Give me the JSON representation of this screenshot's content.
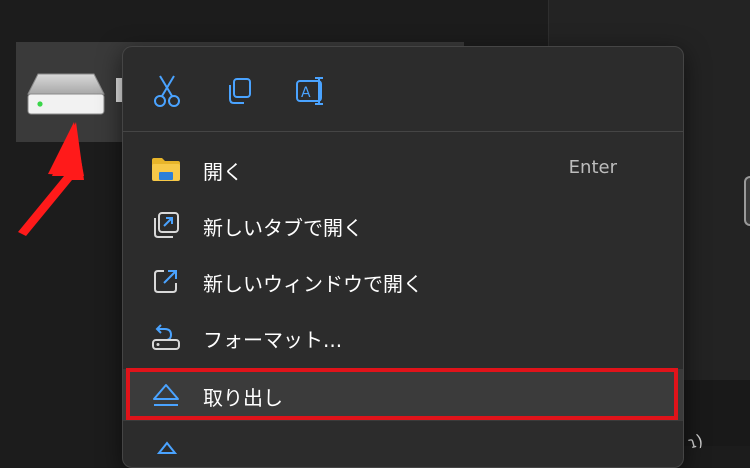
{
  "background": {
    "dark": "#1c1c1c",
    "panel": "#232323"
  },
  "drive": {
    "icon": "hard-drive-icon",
    "tile_color": "#3a3a3a",
    "status_led": "#3bd64a"
  },
  "annotation": {
    "arrow_color": "#ff1a1a",
    "highlight_color": "#e0131a"
  },
  "context_menu": {
    "toolbar": [
      {
        "icon": "cut-icon",
        "name": "cut"
      },
      {
        "icon": "copy-icon",
        "name": "copy"
      },
      {
        "icon": "rename-icon",
        "name": "rename"
      }
    ],
    "items": [
      {
        "label": "開く",
        "shortcut": "Enter",
        "icon": "folder-icon"
      },
      {
        "label": "新しいタブで開く",
        "shortcut": "",
        "icon": "open-in-new-tab-icon"
      },
      {
        "label": "新しいウィンドウで開く",
        "shortcut": "",
        "icon": "open-in-new-window-icon"
      },
      {
        "label": "フォーマット...",
        "shortcut": "",
        "icon": "format-drive-icon"
      },
      {
        "label": "取り出し",
        "shortcut": "",
        "icon": "eject-icon",
        "highlighted": true
      }
    ],
    "accent": "#4aa3ff"
  }
}
